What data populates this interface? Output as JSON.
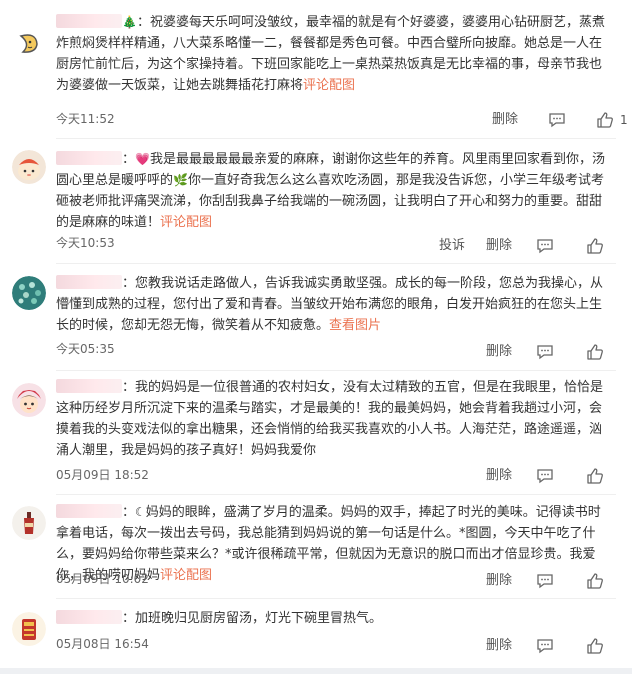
{
  "comments": [
    {
      "name_suffix": "🎄",
      "text": "祝婆婆每天乐呵呵没皱纹，最幸福的就是有个好婆婆，婆婆用心钻研厨艺，蒸煮炸煎焖煲样样精通，八大菜系略懂一二，餐餐都是秀色可餐。中西合璧所向披靡。她总是一人在厨房忙前忙后，为这个家操持着。下班回家能吃上一桌热菜热饭真是无比幸福的事，母亲节我也为婆婆做一天饭菜，让她去跳舞插花打麻将",
      "link": "评论配图",
      "time": "今天11:52",
      "delete": "删除",
      "like_count": "1"
    },
    {
      "lead_emoji": "💗",
      "text": "我是最最最最最最亲爱的麻麻，谢谢你这些年的养育。风里雨里回家看到你，汤圆心里总是暖呼呼的",
      "mid_emoji": "🌿",
      "text2": "你一直好奇我怎么这么喜欢吃汤圆，那是我没告诉您，小学三年级考试考砸被老师批评痛哭流涕，你刮刮我鼻子给我端的一碗汤圆，让我明白了开心和努力的重要。甜甜的是麻麻的味道！",
      "link": "评论配图",
      "time": "今天10:53",
      "report": "投诉",
      "delete": "删除"
    },
    {
      "text": "您教我说话走路做人，告诉我诚实勇敢坚强。成长的每一阶段，您总为我操心，从懵懂到成熟的过程，您付出了爱和青春。当皱纹开始布满您的眼角，白发开始疯狂的在您头上生长的时候，您却无怨无悔，微笑着从不知疲惫。",
      "link": "查看图片",
      "time": "今天05:35",
      "delete": "删除"
    },
    {
      "text": "我的妈妈是一位很普通的农村妇女，没有太过精致的五官，但是在我眼里，恰恰是这种历经岁月所沉淀下来的温柔与踏实，才是最美的！我的最美妈妈，她会背着我趟过小河，会摸着我的头变戏法似的拿出糖果，还会悄悄的给我买我喜欢的小人书。人海茫茫，路途遥遥，汹涌人潮里，我是妈妈的孩子真好！妈妈我爱你",
      "time": "05月09日 18:52",
      "delete": "删除"
    },
    {
      "lead_symbol": "☾",
      "text": "妈妈的眼眸，盛满了岁月的温柔。妈妈的双手，捧起了时光的美味。记得读书时拿着电话，每次一拨出去号码，我总能猜到妈妈说的第一句话是什么。*图圆，今天中午吃了什么，要妈妈给你带些菜来么？*或许很稀疏平常，但就因为无意识的脱口而出才倍显珍贵。我爱你，我的唠叨妈妈",
      "link": "评论配图",
      "time": "05月09日 10:02",
      "delete": "删除"
    },
    {
      "text": "加班晚归见厨房留汤，灯光下碗里冒热气。",
      "time": "05月08日 16:54",
      "delete": "删除"
    }
  ],
  "colors": {
    "link": "#eb7350",
    "text": "#333333",
    "time": "#666666",
    "divider": "#efefef"
  },
  "icons": [
    "comment-icon",
    "like-icon"
  ]
}
